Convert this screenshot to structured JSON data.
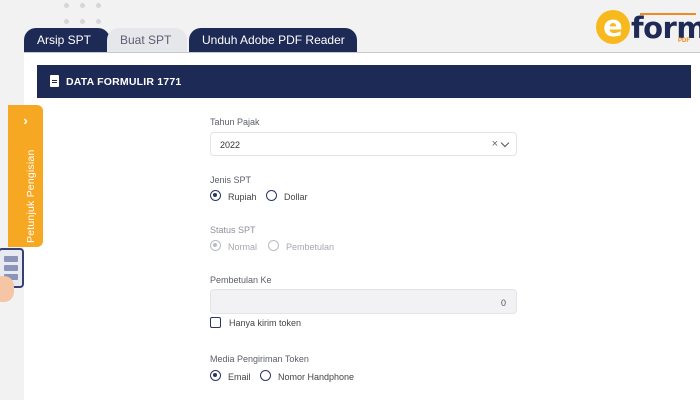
{
  "tabs": [
    {
      "label": "Arsip SPT",
      "state": "active-dark"
    },
    {
      "label": "Buat SPT",
      "state": "inactive"
    },
    {
      "label": "Unduh Adobe PDF Reader",
      "state": "active-dark"
    }
  ],
  "logo": {
    "e": "e",
    "form": "form",
    "pdf": "PDF"
  },
  "header": {
    "title": "DATA FORMULIR 1771",
    "icon": "document-icon"
  },
  "side_tab": {
    "label": "Petunjuk Pengisian",
    "chevron": "›"
  },
  "form": {
    "tahun_pajak": {
      "label": "Tahun Pajak",
      "value": "2022",
      "clear": "×"
    },
    "jenis_spt": {
      "label": "Jenis SPT",
      "options": [
        {
          "label": "Rupiah",
          "checked": true
        },
        {
          "label": "Dollar",
          "checked": false
        }
      ]
    },
    "status_spt": {
      "label": "Status SPT",
      "options": [
        {
          "label": "Normal",
          "checked": true
        },
        {
          "label": "Pembetulan",
          "checked": false
        }
      ],
      "disabled": true
    },
    "pembetulan_ke": {
      "label": "Pembetulan Ke",
      "value": "0"
    },
    "hanya_kirim_token": {
      "label": "Hanya kirim token",
      "checked": false
    },
    "media_pengiriman": {
      "label": "Media Pengiriman Token",
      "options": [
        {
          "label": "Email",
          "checked": true
        },
        {
          "label": "Nomor Handphone",
          "checked": false
        }
      ]
    }
  },
  "colors": {
    "navy": "#1e2a56",
    "accent": "#f7a823",
    "background": "#f2f2f3"
  }
}
